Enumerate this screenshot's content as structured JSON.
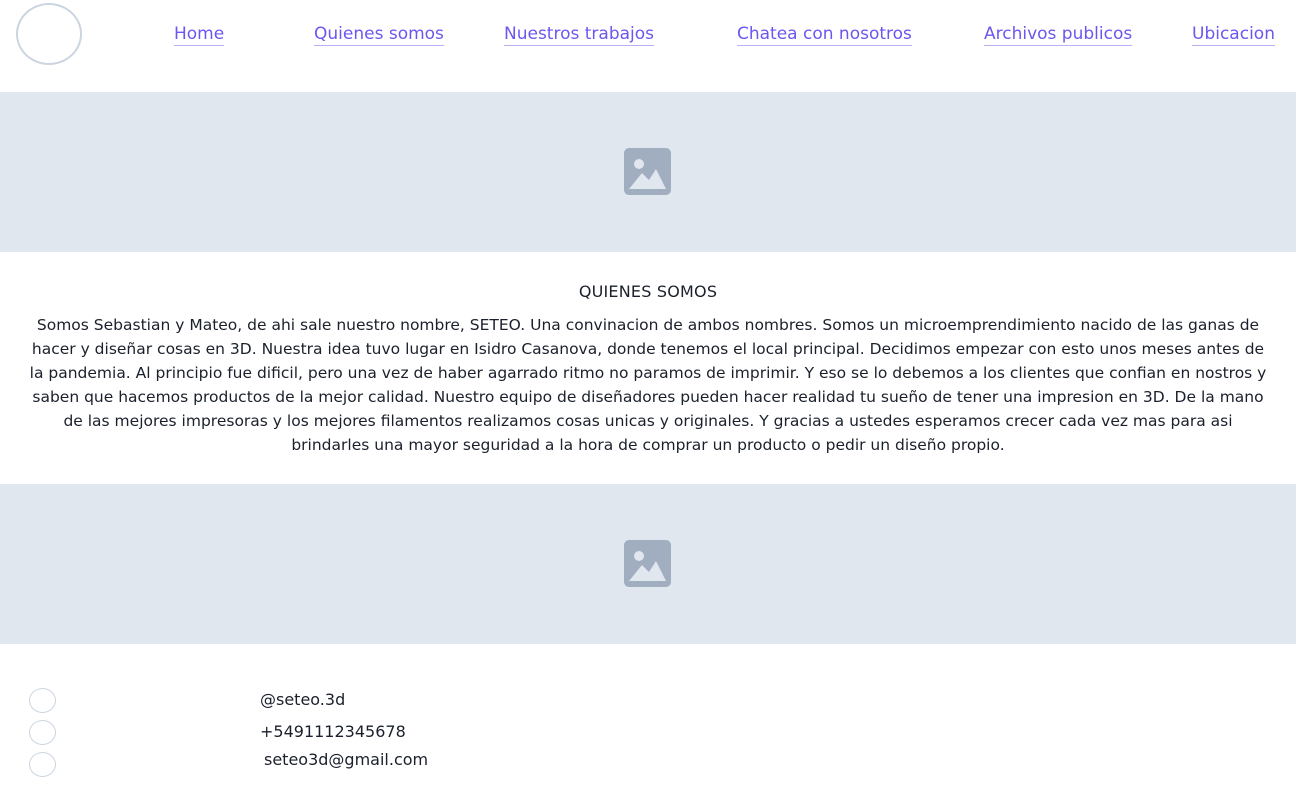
{
  "nav": {
    "items": [
      {
        "label": "Home"
      },
      {
        "label": "Quienes somos"
      },
      {
        "label": "Nuestros trabajos"
      },
      {
        "label": "Chatea con nosotros"
      },
      {
        "label": "Archivos publicos"
      },
      {
        "label": "Ubicacion"
      }
    ]
  },
  "about": {
    "title": "QUIENES SOMOS",
    "text": "Somos Sebastian y Mateo, de ahi sale nuestro nombre, SETEO. Una convinacion de ambos nombres. Somos un microemprendimiento nacido de las ganas de hacer y diseñar cosas en 3D. Nuestra idea tuvo lugar en Isidro Casanova, donde tenemos el local principal. Decidimos empezar con esto unos meses antes de la pandemia. Al principio fue dificil, pero una vez de haber agarrado ritmo no paramos de imprimir. Y eso se lo debemos a los clientes que confian en nostros y saben que hacemos productos de la mejor calidad. Nuestro equipo de diseñadores pueden hacer realidad tu sueño de tener una impresion en 3D. De la mano de las mejores impresoras y los mejores filamentos realizamos cosas unicas y originales. Y gracias a ustedes esperamos crecer cada vez mas para asi brindarles una mayor seguridad a la hora de comprar un producto o pedir un diseño propio."
  },
  "contact": {
    "instagram": "@seteo.3d",
    "phone": "+5491112345678",
    "email": "seteo3d@gmail.com"
  },
  "colors": {
    "link": "#6b57f0",
    "placeholder_bg": "#e1e7ef",
    "placeholder_icon": "#a0aec0"
  },
  "icons": {
    "placeholder": "image-icon",
    "contact": "circle-icon"
  }
}
